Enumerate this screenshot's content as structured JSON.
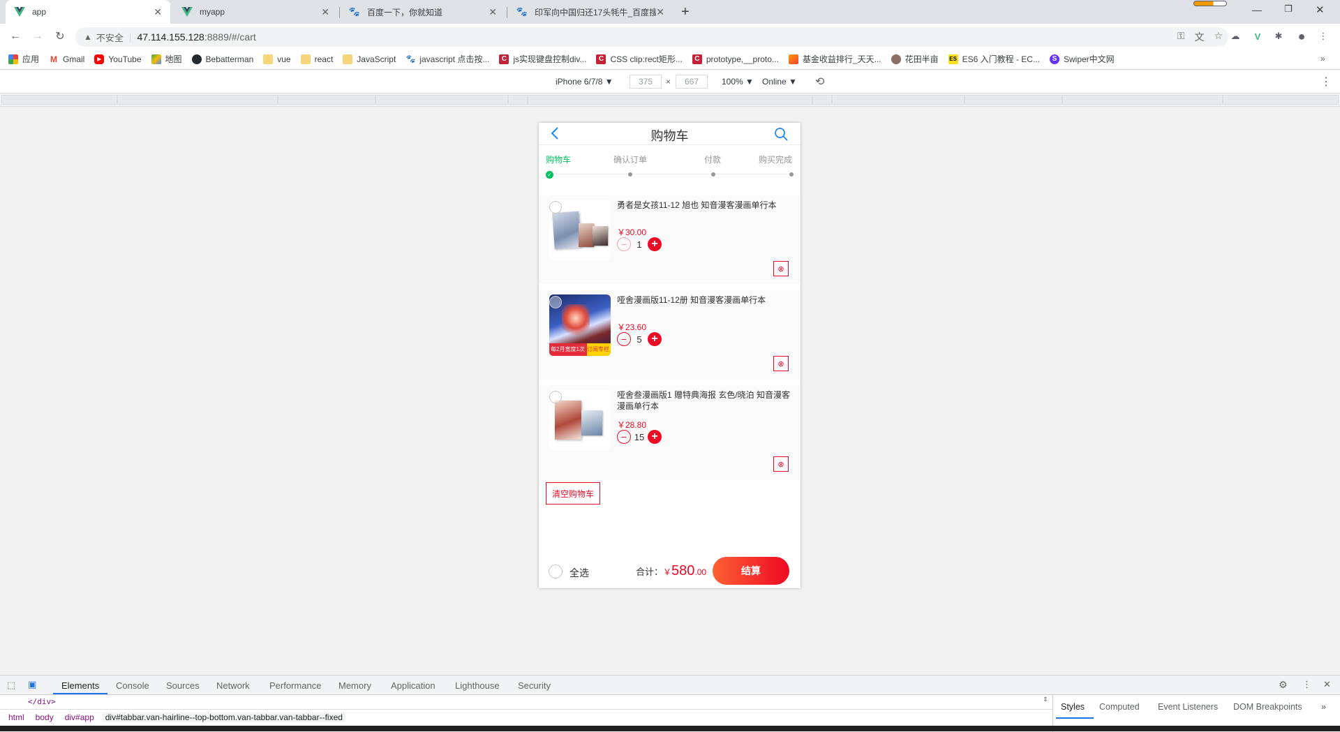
{
  "browser": {
    "tabs": [
      {
        "title": "app",
        "active": true
      },
      {
        "title": "myapp",
        "active": false
      },
      {
        "title": "百度一下，你就知道",
        "active": false
      },
      {
        "title": "印军向中国归还17头牦牛_百度搜",
        "active": false
      }
    ],
    "new_tab": "+",
    "address": {
      "security": "不安全",
      "host": "47.114.155.128",
      "rest": ":8889/#/cart"
    },
    "bookmarks": [
      {
        "label": "应用",
        "icon": "apps-grid-icon"
      },
      {
        "label": "Gmail",
        "icon": "gmail-icon"
      },
      {
        "label": "YouTube",
        "icon": "youtube-icon"
      },
      {
        "label": "地图",
        "icon": "maps-icon"
      },
      {
        "label": "Bebatterman",
        "icon": "github-icon"
      },
      {
        "label": "vue",
        "icon": "folder-icon"
      },
      {
        "label": "react",
        "icon": "folder-icon"
      },
      {
        "label": "JavaScript",
        "icon": "folder-icon"
      },
      {
        "label": "javascript 点击按...",
        "icon": "baidu-paw-icon"
      },
      {
        "label": "js实现键盘控制div...",
        "icon": "csdn-icon"
      },
      {
        "label": "CSS clip:rect矩形...",
        "icon": "csdn-icon"
      },
      {
        "label": "prototype,__proto...",
        "icon": "csdn-icon"
      },
      {
        "label": "基金收益排行_天天...",
        "icon": "fund-icon"
      },
      {
        "label": "花田半亩",
        "icon": "avatar-icon"
      },
      {
        "label": "ES6 入门教程 - EC...",
        "icon": "es6-icon"
      },
      {
        "label": "Swiper中文网",
        "icon": "swiper-icon"
      }
    ],
    "bookmarks_more": "»"
  },
  "device_toolbar": {
    "device": "iPhone 6/7/8 ▼",
    "width": "375",
    "x": "×",
    "height": "667",
    "zoom": "100% ▼",
    "network": "Online ▼"
  },
  "cart": {
    "title": "购物车",
    "steps": [
      {
        "label": "购物车",
        "active": true
      },
      {
        "label": "确认订单",
        "active": false
      },
      {
        "label": "付款",
        "active": false
      },
      {
        "label": "购买完成",
        "active": false
      }
    ],
    "items": [
      {
        "name": "勇者是女孩11-12 旭也 知音漫客漫画单行本",
        "price": "￥30.00",
        "qty": "1",
        "minus_disabled": true
      },
      {
        "name": "哑舍漫画版11-12册 知音漫客漫画单行本",
        "price": "￥23.60",
        "qty": "5",
        "minus_disabled": false,
        "cover_banner_left": "每2月宽度1次",
        "cover_banner_right": "订阅专栏"
      },
      {
        "name": "哑舍叁漫画版1 赠特典海报 玄色/晓泊 知音漫客漫画单行本",
        "price": "￥28.80",
        "qty": "15",
        "minus_disabled": false
      }
    ],
    "delete_glyph": "⊗",
    "clear_button": "清空购物车",
    "select_all": "全选",
    "total_label": "合计：",
    "total_currency": "￥",
    "total_int": "580",
    "total_dec": ".00",
    "checkout_button": "结算",
    "colors": {
      "accent": "#ee0a24",
      "step_active": "#07c160"
    }
  },
  "devtools": {
    "tabs": [
      "Elements",
      "Console",
      "Sources",
      "Network",
      "Performance",
      "Memory",
      "Application",
      "Lighthouse",
      "Security"
    ],
    "code_line": "</div>",
    "breadcrumbs": [
      "html",
      "body",
      "div#app",
      "div#tabbar.van-hairline--top-bottom.van-tabbar.van-tabbar--fixed"
    ],
    "side_tabs": [
      "Styles",
      "Computed",
      "Event Listeners",
      "DOM Breakpoints"
    ],
    "side_more": "»"
  }
}
